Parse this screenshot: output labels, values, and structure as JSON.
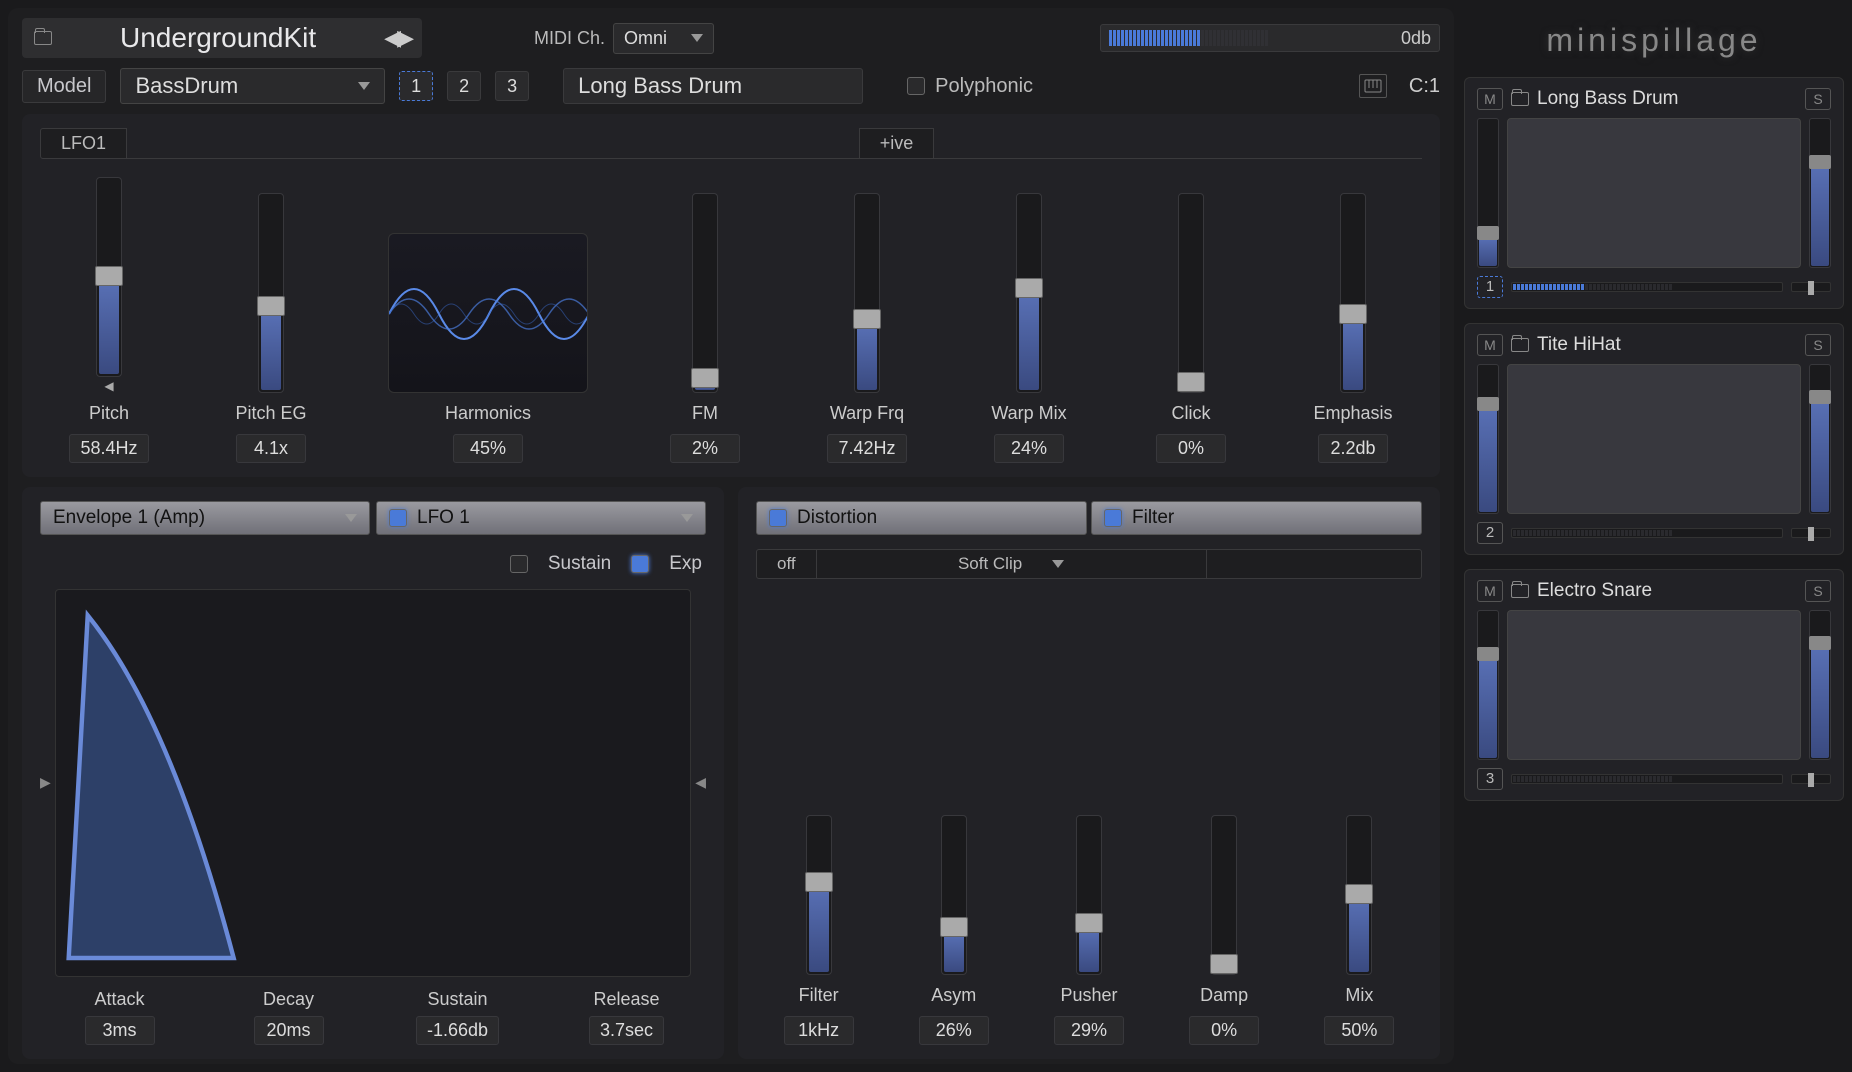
{
  "top": {
    "preset_name": "UndergroundKit",
    "midi_label": "MIDI Ch.",
    "midi_value": "Omni",
    "db": "0db"
  },
  "model": {
    "label": "Model",
    "value": "BassDrum",
    "pads": [
      "1",
      "2",
      "3"
    ],
    "selected_pad": 0,
    "pad_name": "Long Bass Drum",
    "polyphonic": "Polyphonic",
    "cc": "C:1"
  },
  "osc": {
    "tab_lfo": "LFO1",
    "tab_ive": "+ive",
    "sliders": {
      "pitch": {
        "label": "Pitch",
        "value": "58.4Hz",
        "pos": 0.5
      },
      "pitch_eg": {
        "label": "Pitch EG",
        "value": "4.1x",
        "pos": 0.42
      },
      "harmonics": {
        "label": "Harmonics",
        "value": "45%"
      },
      "fm": {
        "label": "FM",
        "value": "2%",
        "pos": 0.02
      },
      "warp_frq": {
        "label": "Warp Frq",
        "value": "7.42Hz",
        "pos": 0.35
      },
      "warp_mix": {
        "label": "Warp Mix",
        "value": "24%",
        "pos": 0.52
      },
      "click": {
        "label": "Click",
        "value": "0%",
        "pos": 0.0
      },
      "emphasis": {
        "label": "Emphasis",
        "value": "2.2db",
        "pos": 0.38
      }
    }
  },
  "env": {
    "sel1": "Envelope 1 (Amp)",
    "sel2": "LFO 1",
    "sustain": "Sustain",
    "exp": "Exp",
    "params": {
      "attack": {
        "label": "Attack",
        "value": "3ms"
      },
      "decay": {
        "label": "Decay",
        "value": "20ms"
      },
      "sustain": {
        "label": "Sustain",
        "value": "-1.66db"
      },
      "release": {
        "label": "Release",
        "value": "3.7sec"
      }
    }
  },
  "dist": {
    "tab_dist": "Distortion",
    "tab_filt": "Filter",
    "mode_off": "off",
    "mode_type": "Soft Clip",
    "sliders": {
      "filter": {
        "label": "Filter",
        "value": "1kHz",
        "pos": 0.58
      },
      "asym": {
        "label": "Asym",
        "value": "26%",
        "pos": 0.26
      },
      "pusher": {
        "label": "Pusher",
        "value": "29%",
        "pos": 0.29
      },
      "damp": {
        "label": "Damp",
        "value": "0%",
        "pos": 0.0
      },
      "mix": {
        "label": "Mix",
        "value": "50%",
        "pos": 0.5
      }
    }
  },
  "side": {
    "logo": "minispillage",
    "pads": [
      {
        "name": "Long Bass Drum",
        "num": "1",
        "pan_pos": 0.2,
        "vol_pos": 0.72,
        "meter_active": true,
        "selected": true
      },
      {
        "name": "Tite HiHat",
        "num": "2",
        "pan_pos": 0.75,
        "vol_pos": 0.8,
        "meter_active": false,
        "selected": false
      },
      {
        "name": "Electro Snare",
        "num": "3",
        "pan_pos": 0.72,
        "vol_pos": 0.8,
        "meter_active": false,
        "selected": false
      }
    ]
  }
}
